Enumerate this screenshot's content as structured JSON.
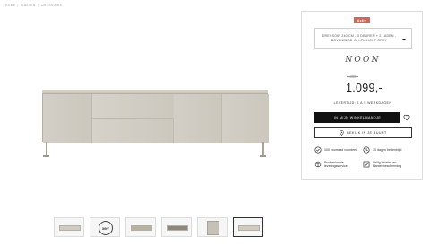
{
  "breadcrumb": [
    "Home",
    "Kasten",
    "Dressoirs"
  ],
  "badge": "Actie",
  "variant": {
    "label": "DRESSOIR 240 CM - 3 DEUREN + 2 LADEN - BOVENBLAD IN HPL LIGHT GREY"
  },
  "product": {
    "brand": "NOON",
    "old_price": "1.399,-",
    "price": "1.099,-"
  },
  "delivery": "Levertijd: 3 à 5 werkdagen",
  "buttons": {
    "cart": "In mijn winkelmandje",
    "store": "Bekijk in je buurt"
  },
  "usps": [
    {
      "icon": "returns-icon",
      "text": "100 voorraad voordeel"
    },
    {
      "icon": "calendar-icon",
      "text": "30 dagen bedenktijd"
    },
    {
      "icon": "box-icon",
      "text": "Professionele leveringsservice"
    },
    {
      "icon": "secure-payment-icon",
      "text": "Veilig betalen en klantenbescherming"
    }
  ],
  "gallery": {
    "thumbnails": [
      "front-view",
      "360-view",
      "angle-view",
      "interior-view",
      "detail-view",
      "front-view-selected"
    ],
    "rotate_label": "360°"
  },
  "colors": {
    "badge": "#c86b5a",
    "cart_button": "#111111",
    "sideboard": "#cfcbc1"
  }
}
